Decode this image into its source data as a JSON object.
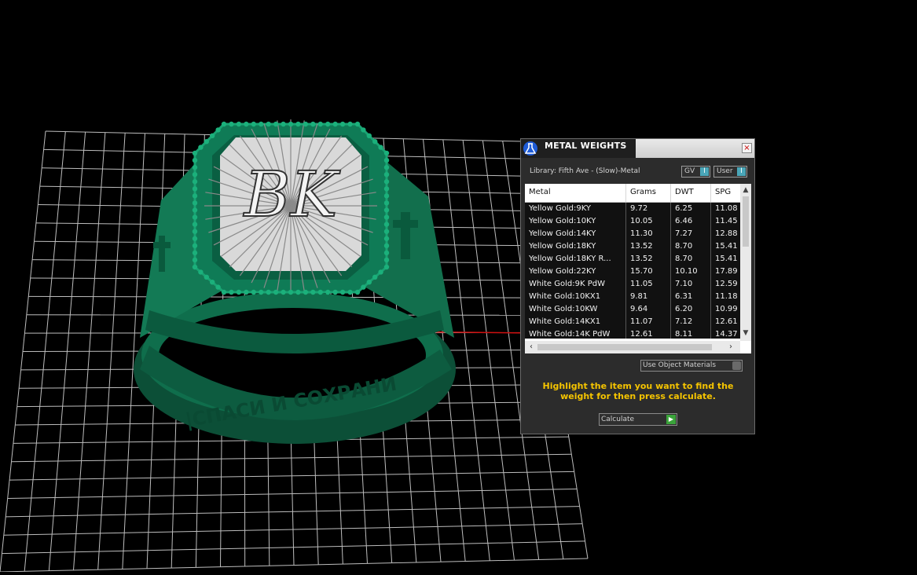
{
  "viewport": {
    "ring_engraving_top": "BK",
    "ring_band_text": "|СПАСИ И СОХРАНИ",
    "colors": {
      "ring": "#0f6e4c",
      "grid": "#bdbdbd",
      "axis": "#d01010",
      "background": "#000000"
    }
  },
  "panel": {
    "title": "METAL WEIGHTS",
    "close_label": "×",
    "library_label": "Library: Fifth Ave - (Slow)-Metal",
    "toggle_gv": "GV",
    "toggle_user": "User",
    "toggle_icon": "I",
    "columns": [
      "Metal",
      "Grams",
      "DWT",
      "SPG"
    ],
    "rows": [
      [
        "Yellow Gold:9KY",
        "9.72",
        "6.25",
        "11.08"
      ],
      [
        "Yellow Gold:10KY",
        "10.05",
        "6.46",
        "11.45"
      ],
      [
        "Yellow Gold:14KY",
        "11.30",
        "7.27",
        "12.88"
      ],
      [
        "Yellow Gold:18KY",
        "13.52",
        "8.70",
        "15.41"
      ],
      [
        "Yellow Gold:18KY R...",
        "13.52",
        "8.70",
        "15.41"
      ],
      [
        "Yellow Gold:22KY",
        "15.70",
        "10.10",
        "17.89"
      ],
      [
        "White Gold:9K PdW",
        "11.05",
        "7.10",
        "12.59"
      ],
      [
        "White Gold:10KX1",
        "9.81",
        "6.31",
        "11.18"
      ],
      [
        "White Gold:10KW",
        "9.64",
        "6.20",
        "10.99"
      ],
      [
        "White Gold:14KX1",
        "11.07",
        "7.12",
        "12.61"
      ],
      [
        "White Gold:14K PdW",
        "12.61",
        "8.11",
        "14.37"
      ]
    ],
    "use_object_materials": "Use Object Materials",
    "hint": "Highlight the item you want to find the weight for then press calculate.",
    "calculate_label": "Calculate"
  }
}
